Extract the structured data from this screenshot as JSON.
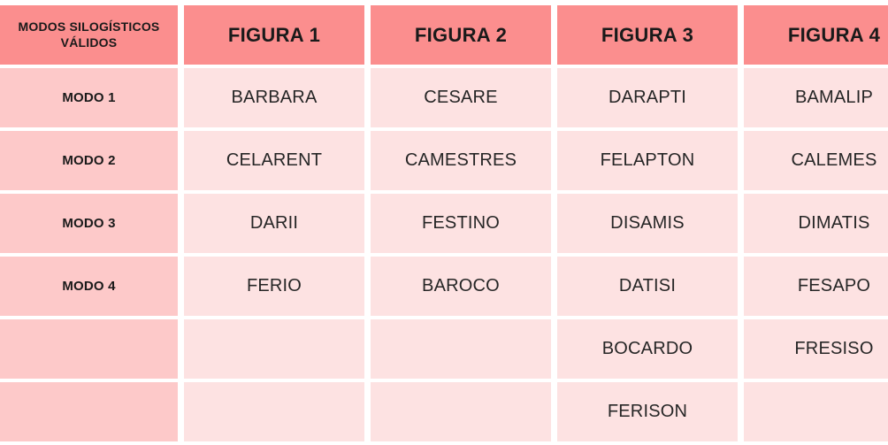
{
  "table": {
    "colors": {
      "header_bg": "#fb8e8e",
      "row_label_bg": "#fdc9c9",
      "data_cell_bg": "#fde2e2",
      "gap": "#ffffff",
      "text": "#1a1a1a"
    },
    "headers": {
      "corner": "MODOS SILOGÍSTICOS VÁLIDOS",
      "corner_line1": "MODOS SILOGÍSTICOS",
      "corner_line2": "VÁLIDOS",
      "columns": [
        "FIGURA 1",
        "FIGURA 2",
        "FIGURA 3",
        "FIGURA 4"
      ]
    },
    "rows": [
      {
        "label": "MODO 1",
        "cells": [
          "BARBARA",
          "CESARE",
          "DARAPTI",
          "BAMALIP"
        ]
      },
      {
        "label": "MODO 2",
        "cells": [
          "CELARENT",
          "CAMESTRES",
          "FELAPTON",
          "CALEMES"
        ]
      },
      {
        "label": "MODO 3",
        "cells": [
          "DARII",
          "FESTINO",
          "DISAMIS",
          "DIMATIS"
        ]
      },
      {
        "label": "MODO 4",
        "cells": [
          "FERIO",
          "BAROCO",
          "DATISI",
          "FESAPO"
        ]
      },
      {
        "label": "",
        "cells": [
          "",
          "",
          "BOCARDO",
          "FRESISO"
        ]
      },
      {
        "label": "",
        "cells": [
          "",
          "",
          "FERISON",
          ""
        ]
      }
    ]
  }
}
